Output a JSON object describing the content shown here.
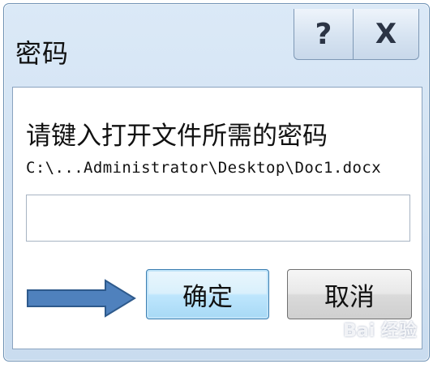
{
  "dialog": {
    "title": "密码",
    "help_label": "?",
    "close_label": "X",
    "prompt": "请键入打开文件所需的密码",
    "file_path": "C:\\...Administrator\\Desktop\\Doc1.docx",
    "password_value": "",
    "ok_label": "确定",
    "cancel_label": "取消"
  },
  "overlay": {
    "arrow_color": "#4f81bd",
    "watermark": "Bai 经验"
  }
}
